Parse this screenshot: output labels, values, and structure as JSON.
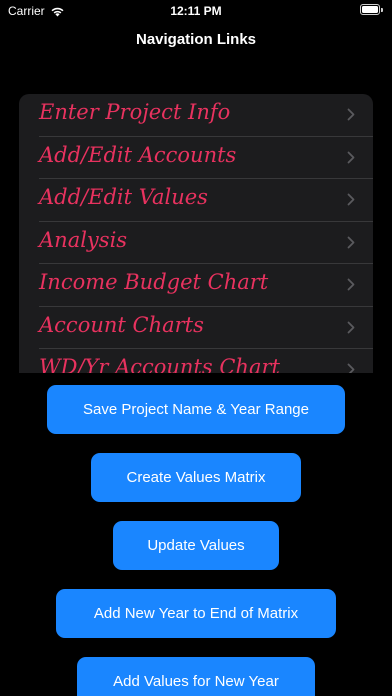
{
  "status_bar": {
    "carrier": "Carrier",
    "time": "12:11 PM",
    "icons": [
      "wifi-icon",
      "battery-icon"
    ]
  },
  "nav": {
    "title": "Navigation Links"
  },
  "list": {
    "items": [
      {
        "label": "Enter Project Info"
      },
      {
        "label": "Add/Edit Accounts"
      },
      {
        "label": "Add/Edit Values"
      },
      {
        "label": "Analysis"
      },
      {
        "label": "Income Budget Chart"
      },
      {
        "label": "Account Charts"
      },
      {
        "label": "WD/Yr Accounts Chart"
      }
    ],
    "label_color": "#e8325f",
    "background_color": "#1c1c1e"
  },
  "buttons": {
    "save_project": "Save Project Name & Year Range",
    "create_matrix": "Create Values Matrix",
    "update_values": "Update Values",
    "add_year": "Add New Year to End of Matrix",
    "add_values": "Add Values for New Year",
    "color": "#1a86ff"
  }
}
